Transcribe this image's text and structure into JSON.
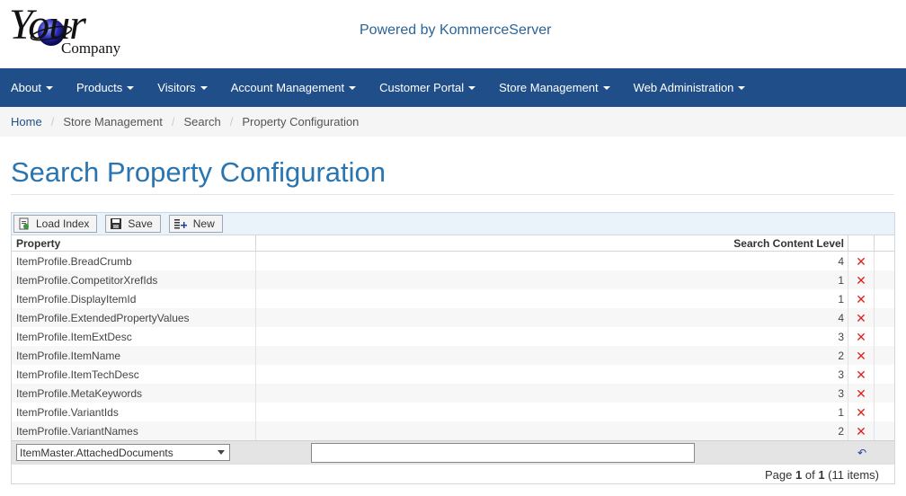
{
  "header": {
    "logo_your": "Your",
    "logo_company": "Company",
    "powered_by": "Powered by KommerceServer"
  },
  "nav": {
    "items": [
      {
        "label": "About"
      },
      {
        "label": "Products"
      },
      {
        "label": "Visitors"
      },
      {
        "label": "Account Management"
      },
      {
        "label": "Customer Portal"
      },
      {
        "label": "Store Management"
      },
      {
        "label": "Web Administration"
      }
    ]
  },
  "breadcrumb": {
    "items": [
      "Home",
      "Store Management",
      "Search",
      "Property Configuration"
    ]
  },
  "page": {
    "title": "Search Property Configuration"
  },
  "toolbar": {
    "load_index_label": "Load Index",
    "save_label": "Save",
    "new_label": "New"
  },
  "grid": {
    "columns": [
      "Property",
      "Search Content Level"
    ],
    "rows": [
      {
        "property": "ItemProfile.BreadCrumb",
        "level": "4"
      },
      {
        "property": "ItemProfile.CompetitorXrefIds",
        "level": "1"
      },
      {
        "property": "ItemProfile.DisplayItemId",
        "level": "1"
      },
      {
        "property": "ItemProfile.ExtendedPropertyValues",
        "level": "4"
      },
      {
        "property": "ItemProfile.ItemExtDesc",
        "level": "3"
      },
      {
        "property": "ItemProfile.ItemName",
        "level": "2"
      },
      {
        "property": "ItemProfile.ItemTechDesc",
        "level": "3"
      },
      {
        "property": "ItemProfile.MetaKeywords",
        "level": "3"
      },
      {
        "property": "ItemProfile.VariantIds",
        "level": "1"
      },
      {
        "property": "ItemProfile.VariantNames",
        "level": "2"
      }
    ],
    "insert": {
      "selected_property": "ItemMaster.AttachedDocuments",
      "level_value": ""
    },
    "pager": {
      "prefix": "Page",
      "current": "1",
      "of": "of",
      "total": "1",
      "items": "(11 items)"
    }
  },
  "colors": {
    "navbar": "#1f4e89",
    "title": "#2a75b0",
    "delete": "#dd2222"
  }
}
